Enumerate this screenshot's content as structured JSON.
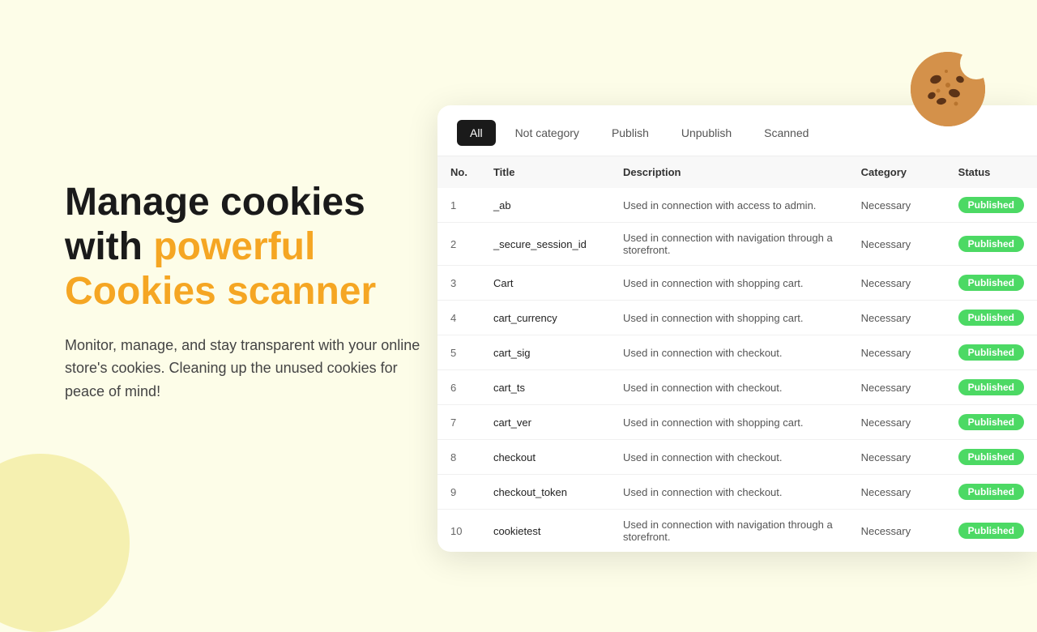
{
  "page": {
    "background_color": "#fdfde8"
  },
  "left": {
    "headline_part1": "Manage cookies",
    "headline_part2": "with ",
    "headline_highlight": "powerful",
    "headline_part3": "Cookies scanner",
    "subtext": "Monitor, manage, and stay transparent with your online store's cookies. Cleaning up the unused cookies for peace of mind!"
  },
  "tabs": {
    "items": [
      {
        "label": "All",
        "active": true
      },
      {
        "label": "Not category",
        "active": false
      },
      {
        "label": "Publish",
        "active": false
      },
      {
        "label": "Unpublish",
        "active": false
      },
      {
        "label": "Scanned",
        "active": false
      }
    ]
  },
  "table": {
    "columns": [
      {
        "key": "no",
        "label": "No."
      },
      {
        "key": "title",
        "label": "Title"
      },
      {
        "key": "description",
        "label": "Description"
      },
      {
        "key": "category",
        "label": "Category"
      },
      {
        "key": "status",
        "label": "Status"
      }
    ],
    "rows": [
      {
        "no": 1,
        "title": "_ab",
        "description": "Used in connection with access to admin.",
        "category": "Necessary",
        "status": "Published"
      },
      {
        "no": 2,
        "title": "_secure_session_id",
        "description": "Used in connection with navigation through a storefront.",
        "category": "Necessary",
        "status": "Published"
      },
      {
        "no": 3,
        "title": "Cart",
        "description": "Used in connection with shopping cart.",
        "category": "Necessary",
        "status": "Published"
      },
      {
        "no": 4,
        "title": "cart_currency",
        "description": "Used in connection with shopping cart.",
        "category": "Necessary",
        "status": "Published"
      },
      {
        "no": 5,
        "title": "cart_sig",
        "description": "Used in connection with checkout.",
        "category": "Necessary",
        "status": "Published"
      },
      {
        "no": 6,
        "title": "cart_ts",
        "description": "Used in connection with checkout.",
        "category": "Necessary",
        "status": "Published"
      },
      {
        "no": 7,
        "title": "cart_ver",
        "description": "Used in connection with shopping cart.",
        "category": "Necessary",
        "status": "Published"
      },
      {
        "no": 8,
        "title": "checkout",
        "description": "Used in connection with checkout.",
        "category": "Necessary",
        "status": "Published"
      },
      {
        "no": 9,
        "title": "checkout_token",
        "description": "Used in connection with checkout.",
        "category": "Necessary",
        "status": "Published"
      },
      {
        "no": 10,
        "title": "cookietest",
        "description": "Used in connection with navigation through a storefront.",
        "category": "Necessary",
        "status": "Published"
      }
    ]
  },
  "status_badge": {
    "label": "Published",
    "color": "#4cd964"
  }
}
